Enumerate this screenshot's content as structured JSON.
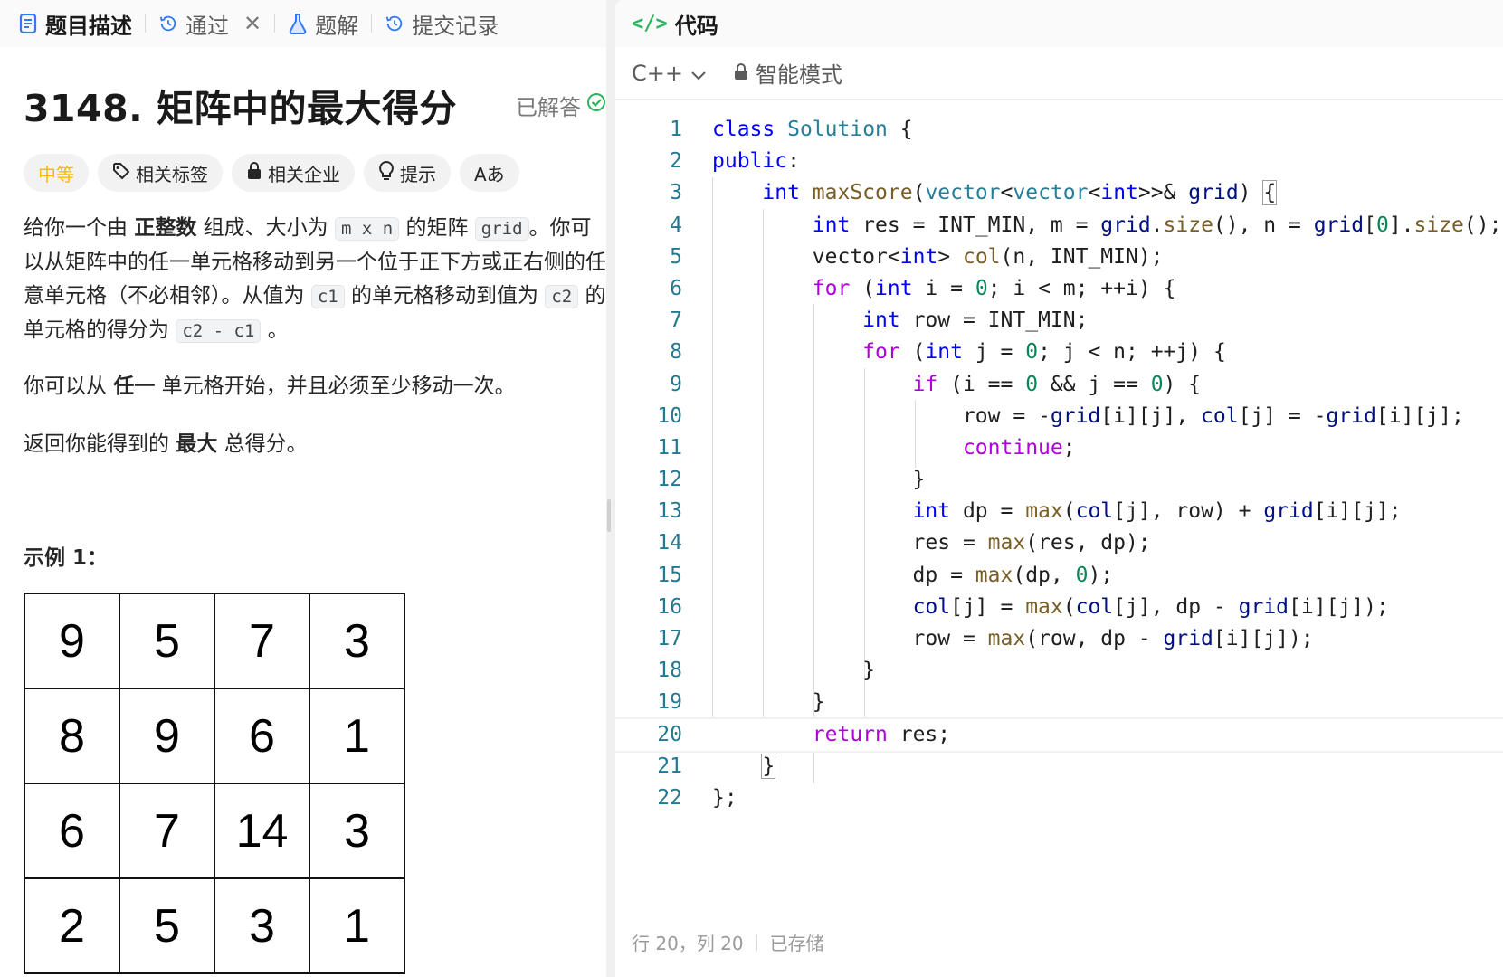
{
  "tabs": {
    "description": "题目描述",
    "passed": "通过",
    "solutions": "题解",
    "submissions": "提交记录"
  },
  "problem": {
    "title": "3148. 矩阵中的最大得分",
    "solved_label": "已解答",
    "tags": {
      "difficulty": "中等",
      "related_tags": "相关标签",
      "companies": "相关企业",
      "hint": "提示",
      "font": "Aあ"
    },
    "desc": {
      "p1a": "给你一个由 ",
      "p1b": "正整数",
      "p1c": " 组成、大小为 ",
      "c1": "m x n",
      "p1d": " 的矩阵 ",
      "c2": "grid",
      "p1e": "。你可以从矩阵中的任一单元格移动到另一个位于正下方或正右侧的任意单元格（不必相邻）。从值为 ",
      "c3": "c1",
      "p1f": " 的单元格移动到值为 ",
      "c4": "c2",
      "p1g": " 的单元格的得分为 ",
      "c5": "c2 - c1",
      "p1h": " 。",
      "p2a": "你可以从 ",
      "p2b": "任一",
      "p2c": " 单元格开始，并且必须至少移动一次。",
      "p3a": "返回你能得到的 ",
      "p3b": "最大",
      "p3c": " 总得分。"
    },
    "example_label": "示例 1：",
    "grid": [
      "9",
      "5",
      "7",
      "3",
      "8",
      "9",
      "6",
      "1",
      "6",
      "7",
      "14",
      "3",
      "2",
      "5",
      "3",
      "1"
    ]
  },
  "editor": {
    "header": "代码",
    "language": "C++",
    "mode": "智能模式",
    "line_numbers": [
      "1",
      "2",
      "3",
      "4",
      "5",
      "6",
      "7",
      "8",
      "9",
      "10",
      "11",
      "12",
      "13",
      "14",
      "15",
      "16",
      "17",
      "18",
      "19",
      "20",
      "21",
      "22"
    ],
    "status_pos": "行 20，列 20",
    "status_saved": "已存储"
  }
}
